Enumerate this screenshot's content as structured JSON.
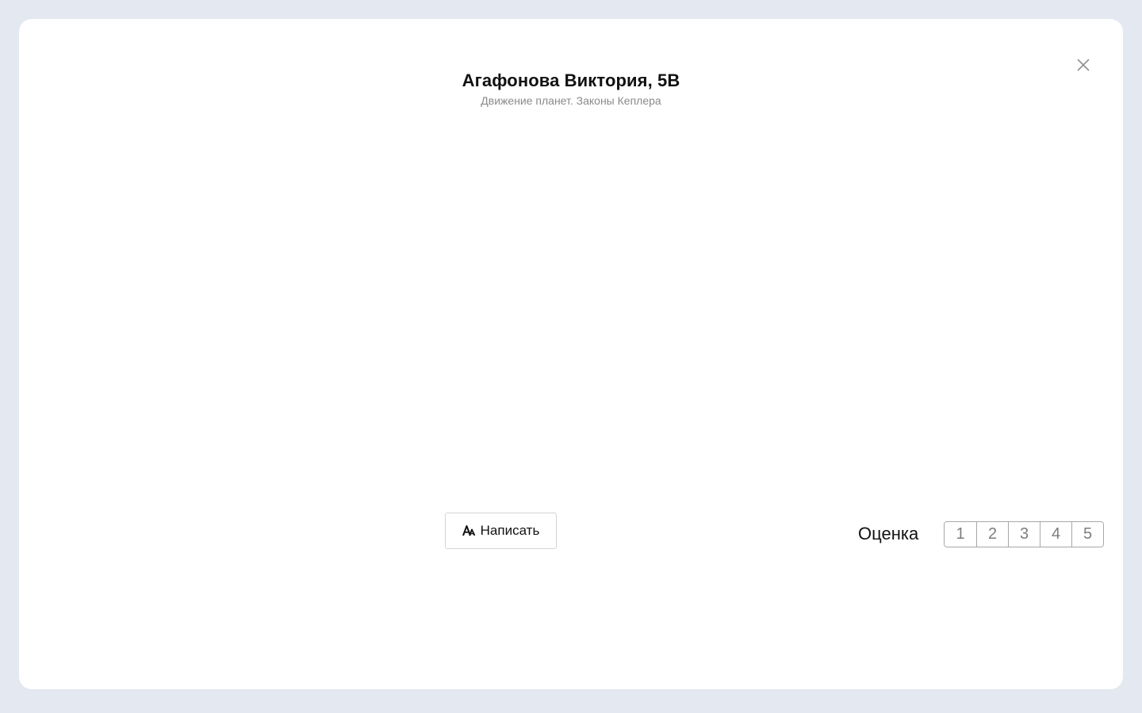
{
  "header": {
    "title": "Агафонова Виктория, 5В",
    "subtitle": "Движение планет. Законы Кеплера"
  },
  "actions": {
    "write_label": "Написать"
  },
  "grade": {
    "label": "Оценка",
    "options": [
      "1",
      "2",
      "3",
      "4",
      "5"
    ]
  },
  "icons": {
    "close": "close-icon",
    "write": "text-font-icon"
  },
  "colors": {
    "background": "#e4e8f0",
    "modal": "#ffffff",
    "title": "#111111",
    "subtitle": "#8a8a8a",
    "grade_text": "#7d7d7d",
    "border": "#a7a7a7"
  }
}
